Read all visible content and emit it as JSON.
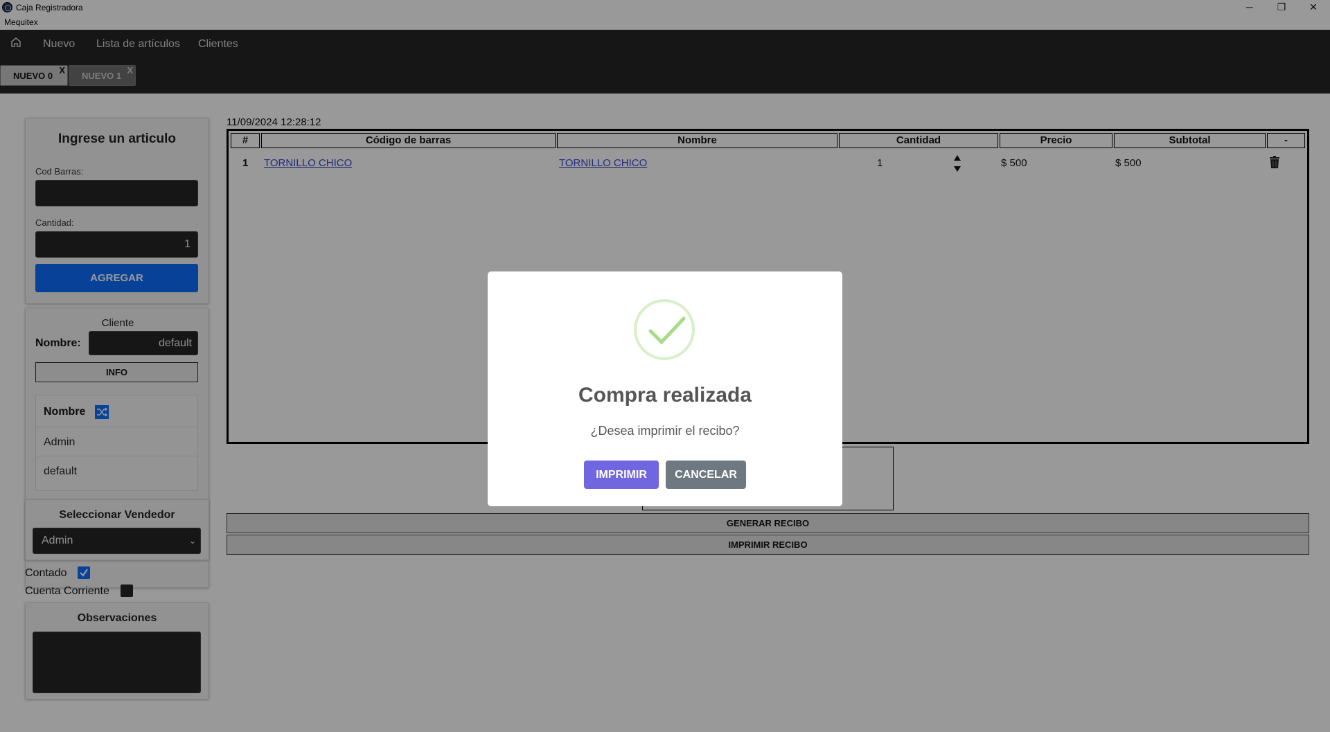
{
  "window": {
    "title": "Caja Registradora",
    "menu": "Mequitex",
    "minimize": "─",
    "restore": "❐",
    "close": "✕"
  },
  "nav": {
    "items": [
      "Nuevo",
      "Lista de artículos",
      "Clientes"
    ]
  },
  "tabs": [
    {
      "label": "NUEVO 0",
      "close": "X"
    },
    {
      "label": "NUEVO 1",
      "close": "X"
    }
  ],
  "article_panel": {
    "title": "Ingrese un articulo",
    "barcode_label": "Cod Barras:",
    "barcode_value": "",
    "qty_label": "Cantidad:",
    "qty_value": "1",
    "add_button": "AGREGAR"
  },
  "client_panel": {
    "title": "Cliente",
    "name_label": "Nombre:",
    "name_value": "default",
    "info_button": "INFO",
    "list_header": "Nombre",
    "list": [
      "Admin",
      "default"
    ]
  },
  "seller_panel": {
    "title": "Seleccionar Vendedor",
    "selected": "Admin"
  },
  "payment": {
    "cash_label": "Contado",
    "cash_checked": true,
    "account_label": "Cuenta Corriente",
    "account_checked": false
  },
  "notes_panel": {
    "title": "Observaciones",
    "value": ""
  },
  "sale": {
    "datetime": "11/09/2024 12:28:12",
    "columns": [
      "#",
      "Código de barras",
      "Nombre",
      "Cantidad",
      "Precio",
      "Subtotal",
      "-"
    ],
    "rows": [
      {
        "num": "1",
        "barcode": "TORNILLO CHICO",
        "name": "TORNILLO CHICO",
        "qty": "1",
        "price": "$ 500",
        "subtotal": "$ 500"
      }
    ]
  },
  "actions": {
    "generate": "GENERAR RECIBO",
    "print": "IMPRIMIR RECIBO"
  },
  "modal": {
    "title": "Compra realizada",
    "text": "¿Desea imprimir el recibo?",
    "confirm": "IMPRIMIR",
    "cancel": "CANCELAR"
  },
  "colors": {
    "primary": "#0d6efd",
    "confirm": "#7066e0",
    "cancel": "#6e7881",
    "dark": "#262626"
  }
}
